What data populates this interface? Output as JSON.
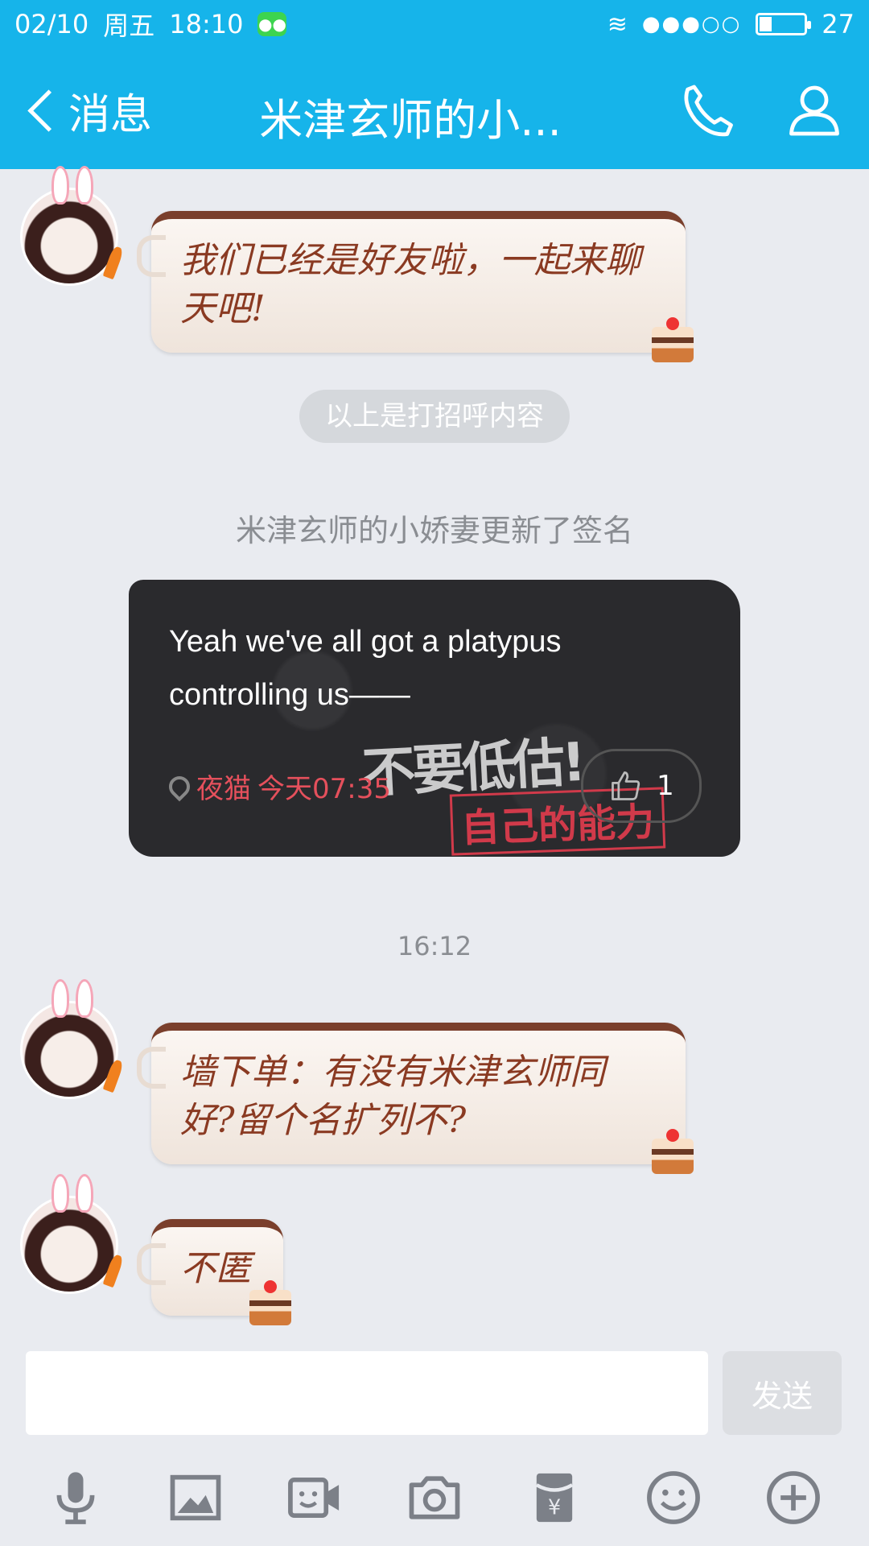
{
  "status": {
    "date": "02/10",
    "weekday": "周五",
    "time": "18:10",
    "battery": "27",
    "battery_fraction": 0.27
  },
  "nav": {
    "back_label": "消息",
    "title": "米津玄师的小..."
  },
  "messages": [
    {
      "text": "我们已经是好友啦，一起来聊天吧!"
    },
    {
      "text": "墙下单：有没有米津玄师同好?留个名扩列不?"
    },
    {
      "text": "不匿"
    }
  ],
  "system": {
    "greeting_divider": "以上是打招呼内容",
    "signature_update": "米津玄师的小娇妻更新了签名"
  },
  "signature_card": {
    "text": "Yeah we've all got a platypus controlling us——",
    "overlay_title": "不要低估!",
    "overlay_subtitle": "自己的能力",
    "location": "夜猫",
    "time": "今天07:35",
    "likes": "1"
  },
  "timestamp": "16:12",
  "composer": {
    "value": "",
    "placeholder": "",
    "send_label": "发送"
  },
  "toolbar": [
    "microphone-icon",
    "image-icon",
    "video-chat-icon",
    "camera-icon",
    "red-packet-icon",
    "emoji-icon",
    "plus-icon"
  ],
  "colors": {
    "header_blue": "#16b4ea",
    "bubble_text": "#8a3a22",
    "location_red": "#e5505c",
    "background": "#e9ebf0"
  }
}
